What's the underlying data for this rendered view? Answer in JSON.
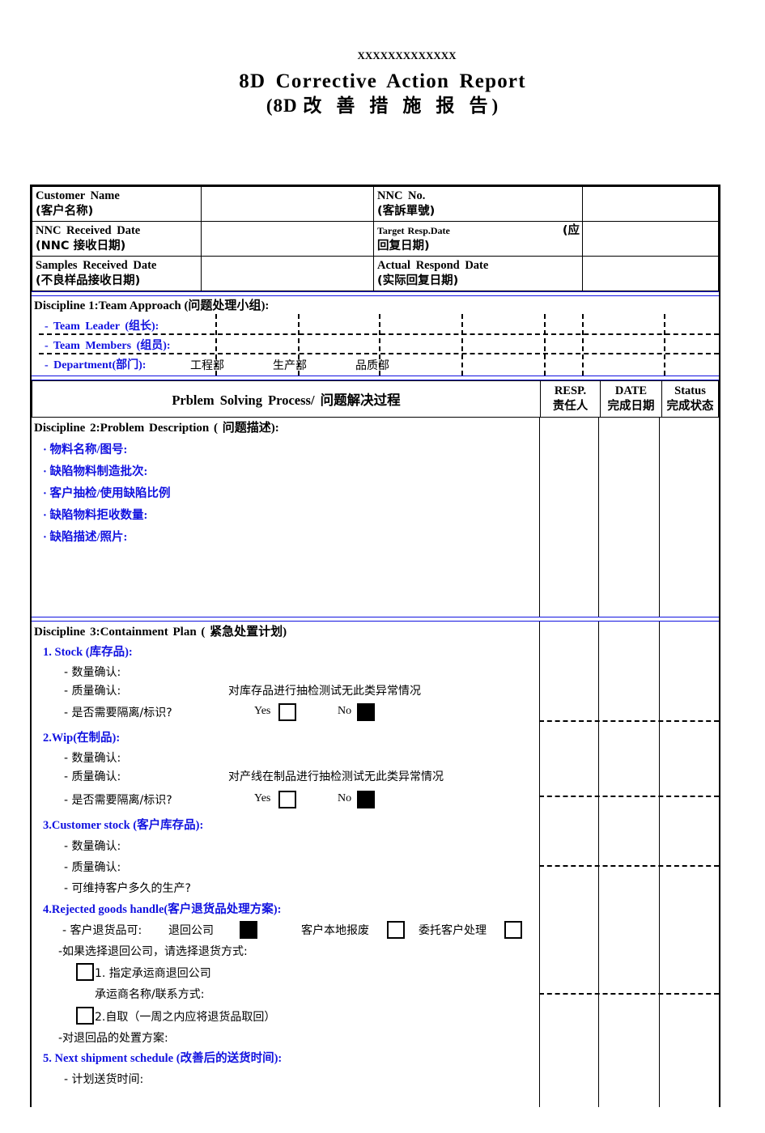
{
  "document": {
    "company_code": "XXXXXXXXXXXXX",
    "title_en": "8D Corrective Action Report",
    "title_cn_prefix": "(8D",
    "title_cn": "改 善 措 施 报 告",
    "title_cn_suffix": ")"
  },
  "header_fields": [
    {
      "label_en": "Customer Name",
      "label_cn": "(客户名称)",
      "value": "",
      "label2_en": "NNC No.",
      "label2_cn": "(客訴單號)",
      "value2": ""
    },
    {
      "label_en": "NNC Received Date",
      "label_cn": "(NNC 接收日期)",
      "value": "",
      "label2_en": "Target Resp.Date",
      "label2_cn": "回复日期)",
      "label2_suffix": "(应",
      "value2": ""
    },
    {
      "label_en": "Samples Received Date",
      "label_cn": "(不良样品接收日期)",
      "value": "",
      "label2_en": "Actual Respond Date",
      "label2_cn": "(实际回复日期)",
      "value2": ""
    }
  ],
  "discipline1": {
    "title": "Discipline 1:Team Approach (问题处理小组):",
    "rows": [
      {
        "label": "- Team Leader (组长):"
      },
      {
        "label": "- Team Members (组员):"
      },
      {
        "label": "- Department(部门):"
      }
    ],
    "departments": [
      "工程部",
      "生产部",
      "品质部"
    ]
  },
  "process_header": {
    "title": "Prblem Solving Process/ 问题解决过程",
    "columns": [
      {
        "en": "RESP.",
        "cn": "责任人"
      },
      {
        "en": "DATE",
        "cn": "完成日期"
      },
      {
        "en": "Status",
        "cn": "完成状态"
      }
    ]
  },
  "discipline2": {
    "title": "Discipline 2:Problem Description ( 问题描述):",
    "items": [
      "· 物料名称/图号:",
      "· 缺陷物料制造批次:",
      "· 客户抽检/使用缺陷比例",
      "· 缺陷物料拒收数量:",
      "· 缺陷描述/照片:"
    ]
  },
  "discipline3": {
    "title": "Discipline 3:Containment Plan ( 紧急处置计划)",
    "stock": {
      "heading": "1. Stock (库存品):",
      "qty_label": "- 数量确认:",
      "quality_label": "- 质量确认:",
      "quality_value": "对库存品进行抽检测试无此类异常情况",
      "isolate_label": "- 是否需要隔离/标识?",
      "yes_label": "Yes",
      "no_label": "No",
      "yes_checked": false,
      "no_checked": true
    },
    "wip": {
      "heading": "2.Wip(在制品):",
      "qty_label": "- 数量确认:",
      "quality_label": "- 质量确认:",
      "quality_value": "对产线在制品进行抽检测试无此类异常情况",
      "isolate_label": "- 是否需要隔离/标识?",
      "yes_label": "Yes",
      "no_label": "No",
      "yes_checked": false,
      "no_checked": true
    },
    "customer_stock": {
      "heading": "3.Customer stock (客户库存品):",
      "qty_label": "- 数量确认:",
      "quality_label": "- 质量确认:",
      "duration_label": "- 可维持客户多久的生产?"
    },
    "rejected": {
      "heading": "4.Rejected goods handle(客户退货品处理方案):",
      "options_label": "- 客户退货品可:",
      "option1": "退回公司",
      "option1_checked": true,
      "option2": "客户本地报废",
      "option2_checked": false,
      "option3": "委托客户处理",
      "option3_checked": false,
      "if_return_label": "-如果选择退回公司，请选择退货方式:",
      "method1": "1. 指定承运商退回公司",
      "method1_checked": false,
      "carrier_label": "承运商名称/联系方式:",
      "method2": "2.自取（一周之内应将退货品取回）",
      "method2_checked": false,
      "disposal_label": "-对退回品的处置方案:"
    },
    "next_shipment": {
      "heading": "5. Next shipment schedule (改善后的送货时间):",
      "plan_label": "- 计划送货时间:"
    }
  },
  "colors": {
    "blue_text": "#1112e0",
    "rule_blue": "#1112e0",
    "border": "#000000"
  }
}
